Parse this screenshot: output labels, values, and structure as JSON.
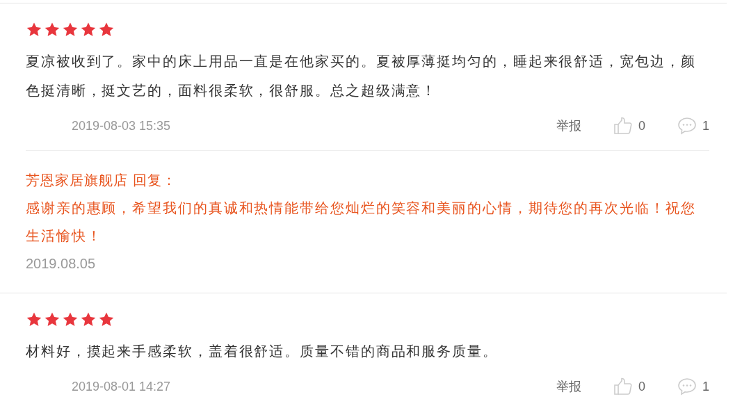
{
  "reviews": [
    {
      "stars": 5,
      "text": "夏凉被收到了。家中的床上用品一直是在他家买的。夏被厚薄挺均匀的，睡起来很舒适，宽包边，颜色挺清晰，挺文艺的，面料很柔软，很舒服。总之超级满意！",
      "date": "2019-08-03 15:35",
      "report": "举报",
      "likes": "0",
      "comments": "1",
      "reply": {
        "author": "芳恩家居旗舰店 回复：",
        "text": "感谢亲的惠顾，希望我们的真诚和热情能带给您灿烂的笑容和美丽的心情，期待您的再次光临！祝您生活愉快！",
        "date": "2019.08.05"
      }
    },
    {
      "stars": 5,
      "text": "材料好，摸起来手感柔软，盖着很舒适。质量不错的商品和服务质量。",
      "date": "2019-08-01 14:27",
      "report": "举报",
      "likes": "0",
      "comments": "1"
    }
  ]
}
